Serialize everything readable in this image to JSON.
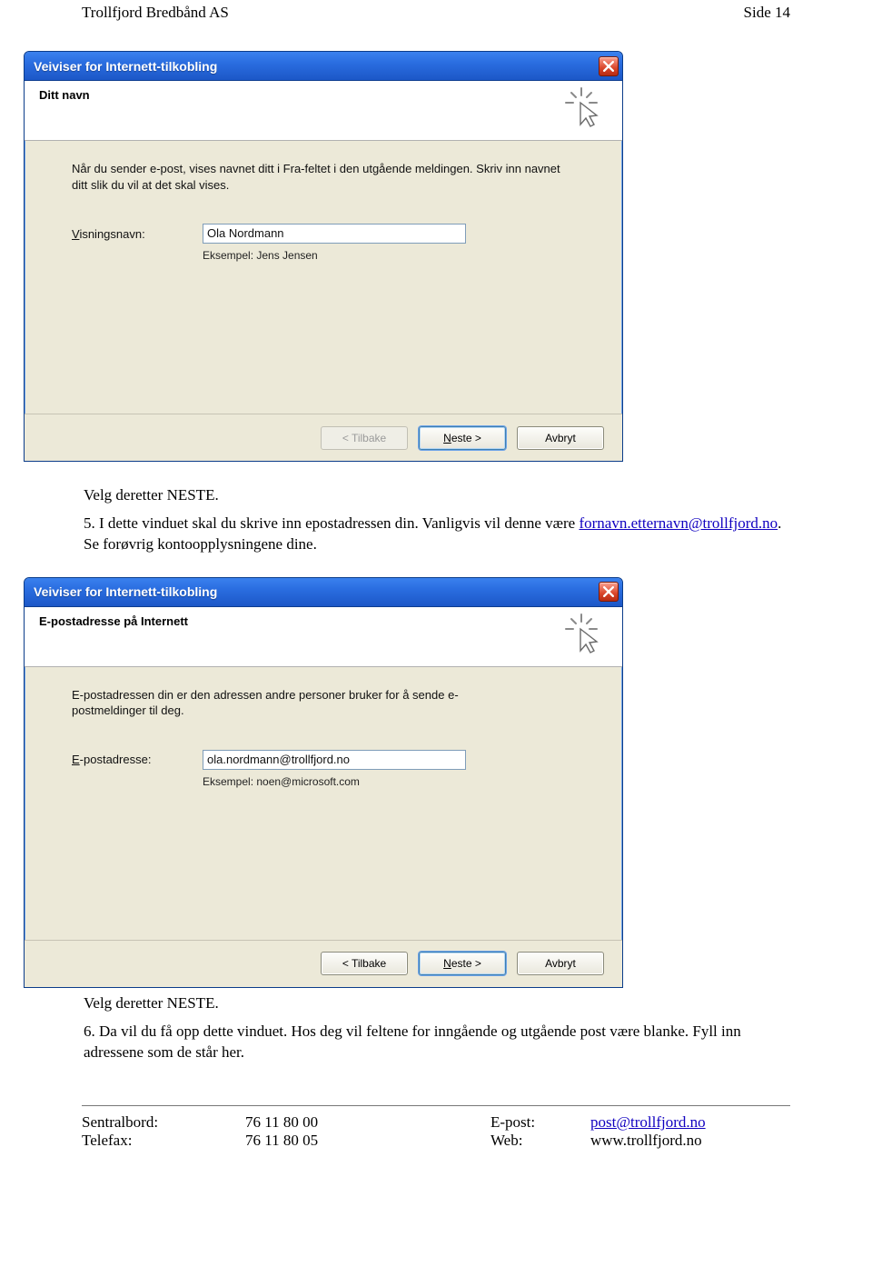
{
  "header": {
    "company": "Trollfjord Bredbånd AS",
    "page_label": "Side 14"
  },
  "wizard1": {
    "window_title": "Veiviser for Internett-tilkobling",
    "step_title": "Ditt navn",
    "instruction": "Når du sender e-post, vises navnet ditt i Fra-feltet i den utgående meldingen. Skriv inn navnet ditt slik du vil at det skal vises.",
    "field_label_pre": "V",
    "field_label_post": "isningsnavn:",
    "field_value": "Ola Nordmann",
    "example": "Eksempel: Jens Jensen",
    "buttons": {
      "back_label": "< Tilbake",
      "next_pre": "N",
      "next_post": "este >",
      "cancel": "Avbryt"
    }
  },
  "mid_text": {
    "line1": "Velg deretter NESTE.",
    "line2a": "5. I dette vinduet skal du skrive inn epostadressen din. Vanligvis vil denne være ",
    "link": "fornavn.etternavn@trollfjord.no",
    "line2b": ". Se forøvrig kontoopplysningene dine."
  },
  "wizard2": {
    "window_title": "Veiviser for Internett-tilkobling",
    "step_title": "E-postadresse på Internett",
    "instruction": "E-postadressen din er den adressen andre personer bruker for å sende e-postmeldinger til deg.",
    "field_label_pre": "E",
    "field_label_post": "-postadresse:",
    "field_value": "ola.nordmann@trollfjord.no",
    "example": "Eksempel: noen@microsoft.com",
    "buttons": {
      "back_pre": "< T",
      "back_post": "ilbake",
      "next_pre": "N",
      "next_post": "este >",
      "cancel": "Avbryt"
    }
  },
  "after_text": {
    "line1": "Velg deretter NESTE.",
    "line2": "6. Da vil du få opp dette vinduet. Hos deg vil feltene for inngående og utgående post være blanke. Fyll inn adressene som de står her."
  },
  "footer": {
    "row1": {
      "k1": "Sentralbord:",
      "v1": "76 11 80 00",
      "k2": "E-post:",
      "v2": "post@trollfjord.no"
    },
    "row2": {
      "k1": "Telefax:",
      "v1": "76 11 80 05",
      "k2": "Web:",
      "v2": "www.trollfjord.no"
    }
  }
}
